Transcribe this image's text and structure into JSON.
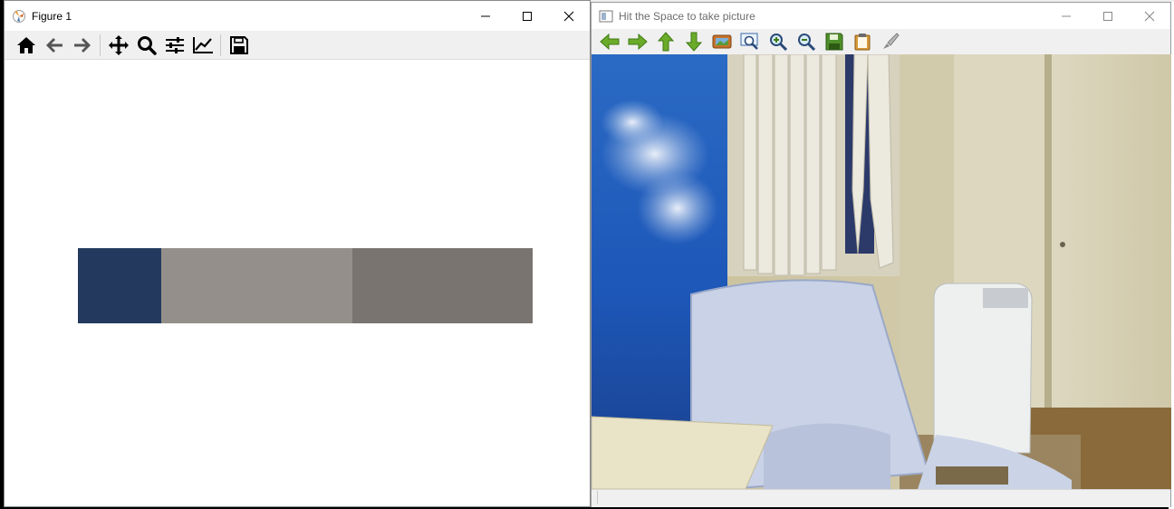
{
  "figure_window": {
    "title": "Figure 1",
    "toolbar": [
      "home-icon",
      "back-arrow-icon",
      "forward-arrow-icon",
      "pan-icon",
      "zoom-icon",
      "configure-subplots-icon",
      "edit-axes-icon",
      "save-icon"
    ],
    "swatches": [
      {
        "color": "#233a5e",
        "fraction": 0.183
      },
      {
        "color": "#958f8b",
        "fraction": 0.421
      },
      {
        "color": "#7a7470",
        "fraction": 0.396
      }
    ]
  },
  "camera_window": {
    "title": "Hit the Space to take picture",
    "toolbar": [
      "pan-left-icon",
      "pan-right-icon",
      "pan-up-icon",
      "pan-down-icon",
      "fit-window-icon",
      "zoom-original-icon",
      "zoom-in-icon",
      "zoom-out-icon",
      "save-image-icon",
      "copy-clipboard-icon",
      "properties-icon"
    ]
  },
  "colors": {
    "accent_green": "#6bab2a",
    "toolbar_bg": "#f0f0f0"
  }
}
